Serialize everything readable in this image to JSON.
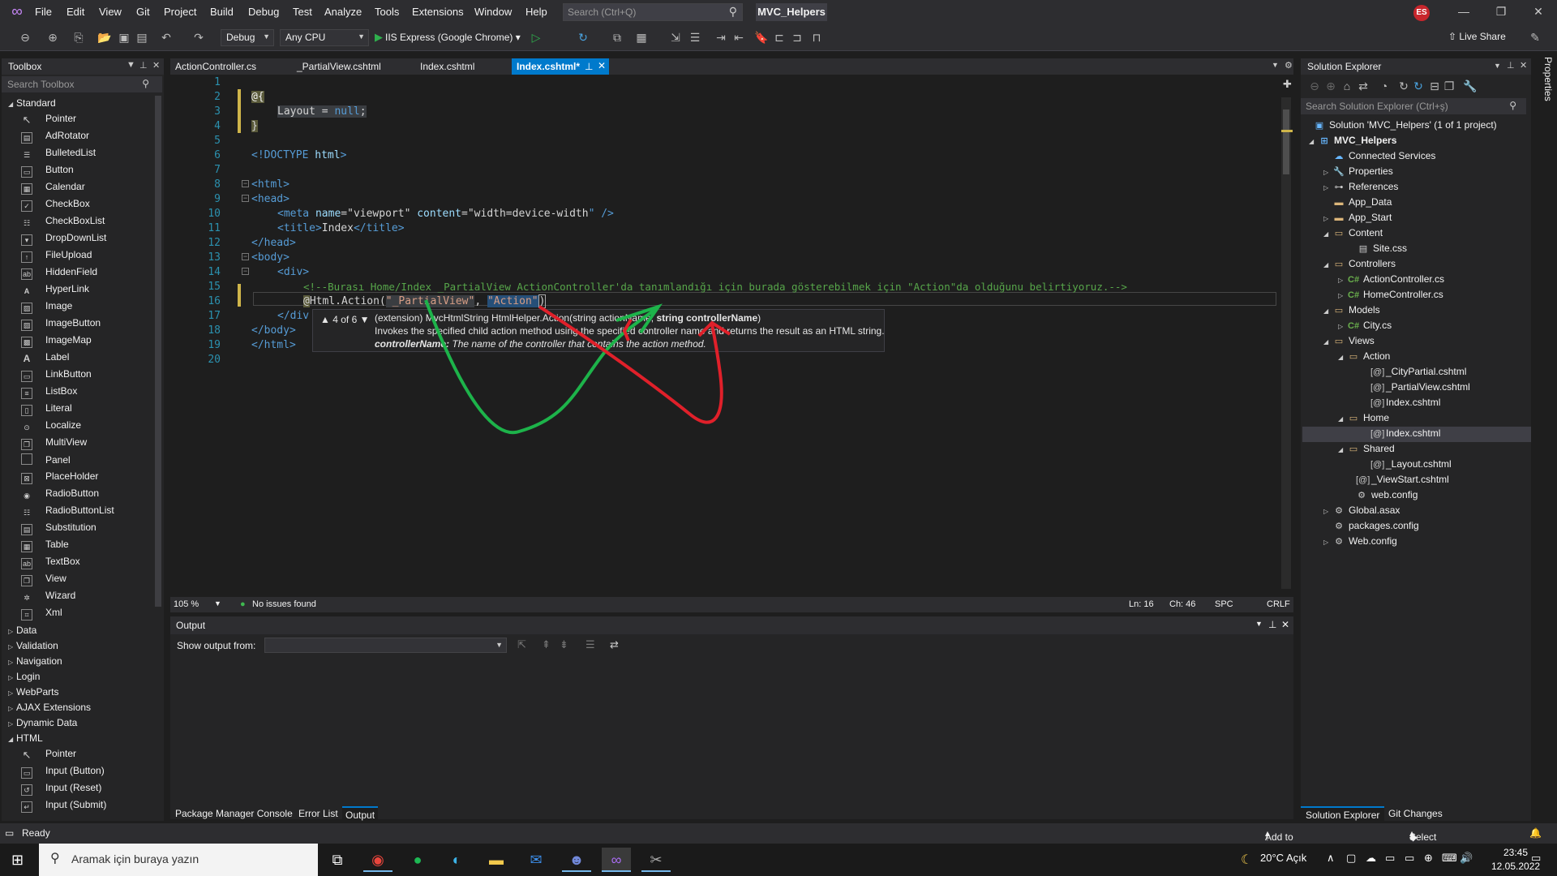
{
  "menubar": {
    "items": [
      "File",
      "Edit",
      "View",
      "Git",
      "Project",
      "Build",
      "Debug",
      "Test",
      "Analyze",
      "Tools",
      "Extensions",
      "Window",
      "Help"
    ],
    "search_placeholder": "Search (Ctrl+Q)",
    "solution_name": "MVC_Helpers",
    "user_initials": "ES"
  },
  "toolbar": {
    "config": "Debug",
    "platform": "Any CPU",
    "run_target": "IIS Express (Google Chrome)",
    "live_share": "Live Share"
  },
  "toolbox": {
    "title": "Toolbox",
    "search_placeholder": "Search Toolbox",
    "standard_label": "Standard",
    "standard_items": [
      "Pointer",
      "AdRotator",
      "BulletedList",
      "Button",
      "Calendar",
      "CheckBox",
      "CheckBoxList",
      "DropDownList",
      "FileUpload",
      "HiddenField",
      "HyperLink",
      "Image",
      "ImageButton",
      "ImageMap",
      "Label",
      "LinkButton",
      "ListBox",
      "Literal",
      "Localize",
      "MultiView",
      "Panel",
      "PlaceHolder",
      "RadioButton",
      "RadioButtonList",
      "Substitution",
      "Table",
      "TextBox",
      "View",
      "Wizard",
      "Xml"
    ],
    "collapsed_categories": [
      "Data",
      "Validation",
      "Navigation",
      "Login",
      "WebParts",
      "AJAX Extensions",
      "Dynamic Data"
    ],
    "html_label": "HTML",
    "html_items": [
      "Pointer",
      "Input (Button)",
      "Input (Reset)",
      "Input (Submit)"
    ]
  },
  "doc_tabs": [
    "ActionController.cs",
    "_PartialView.cshtml",
    "Index.cshtml",
    "Index.cshtml*"
  ],
  "editor": {
    "line_numbers": [
      "1",
      "2",
      "3",
      "4",
      "5",
      "6",
      "7",
      "8",
      "9",
      "10",
      "11",
      "12",
      "13",
      "14",
      "15",
      "16",
      "17",
      "18",
      "19",
      "20"
    ],
    "l2": "@{",
    "l3_a": "Layout",
    "l3_b": " = ",
    "l3_c": "null",
    "l3_d": ";",
    "l4": "}",
    "l6_a": "<!DOCTYPE",
    "l6_b": " html",
    "l6_c": ">",
    "l8": "<html>",
    "l9": "<head>",
    "l10_a": "<meta",
    "l10_b": " name",
    "l10_c": "=\"",
    "l10_d": "viewport",
    "l10_e": "\" ",
    "l10_f": "content",
    "l10_g": "=\"",
    "l10_h": "width=device-width",
    "l10_i": "\" />",
    "l11_a": "<title>",
    "l11_b": "Index",
    "l11_c": "</title>",
    "l12": "</head>",
    "l13": "<body>",
    "l14": "<div>",
    "l15": "<!--Burası Home/Index _PartialView ActionController'da tanımlandığı için burada gösterebilmek için \"Action\"da olduğunu belirtiyoruz.-->",
    "l16_a": "@",
    "l16_b": "Html.Action(",
    "l16_c": "\"_PartialView\"",
    "l16_d": ", ",
    "l16_e": "\"Action\"",
    "l16_f": ")",
    "l17": "</div",
    "l18": "</body>",
    "l19": "</html>"
  },
  "quickinfo": {
    "counter": "4 of 6",
    "signature_a": "(extension) MvcHtmlString HtmlHelper.Action(string actionName, ",
    "signature_b": "string controllerName",
    "signature_c": ")",
    "description": "Invokes the specified child action method using the specified controller name and returns the result as an HTML string.",
    "param_name": "controllerName:",
    "param_desc": " The name of the controller that contains the action method."
  },
  "editor_status": {
    "zoom": "105 %",
    "issues": "No issues found",
    "line": "Ln: 16",
    "col": "Ch: 46",
    "spc": "SPC",
    "eol": "CRLF"
  },
  "output": {
    "title": "Output",
    "show_from_label": "Show output from:",
    "tabs": [
      "Package Manager Console",
      "Error List",
      "Output"
    ]
  },
  "solution_explorer": {
    "title": "Solution Explorer",
    "search_placeholder": "Search Solution Explorer (Ctrl+ş)",
    "solution": "Solution 'MVC_Helpers' (1 of 1 project)",
    "project": "MVC_Helpers",
    "nodes": {
      "connected": "Connected Services",
      "properties": "Properties",
      "references": "References",
      "app_data": "App_Data",
      "app_start": "App_Start",
      "content": "Content",
      "site_css": "Site.css",
      "controllers": "Controllers",
      "action_controller": "ActionController.cs",
      "home_controller": "HomeController.cs",
      "models": "Models",
      "city": "City.cs",
      "views": "Views",
      "action": "Action",
      "city_partial": "_CityPartial.cshtml",
      "partial_view": "_PartialView.cshtml",
      "action_index": "Index.cshtml",
      "home": "Home",
      "home_index": "Index.cshtml",
      "shared": "Shared",
      "layout": "_Layout.cshtml",
      "viewstart": "_ViewStart.cshtml",
      "web_config_views": "web.config",
      "global": "Global.asax",
      "packages": "packages.config",
      "web_config": "Web.config"
    },
    "tabs": [
      "Solution Explorer",
      "Git Changes"
    ],
    "properties_side": "Properties"
  },
  "statusbar": {
    "ready": "Ready",
    "add_source": "Add to Source Control",
    "select_repo": "Select Repository"
  },
  "taskbar": {
    "search_placeholder": "Aramak için buraya yazın",
    "weather": "20°C  Açık",
    "time": "23:45",
    "date": "12.05.2022"
  }
}
